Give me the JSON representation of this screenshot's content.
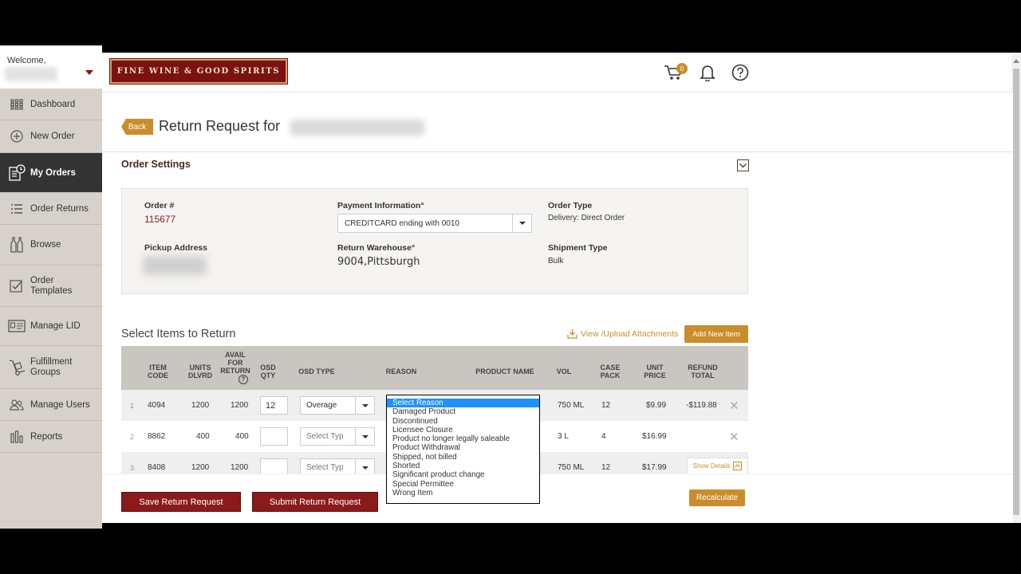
{
  "sidebar": {
    "welcome_label": "Welcome,",
    "items": [
      {
        "label": "Dashboard"
      },
      {
        "label": "New Order"
      },
      {
        "label": "My Orders"
      },
      {
        "label": "Order Returns"
      },
      {
        "label": "Browse"
      },
      {
        "label": "Order Templates"
      },
      {
        "label": "Manage LID"
      },
      {
        "label": "Fulfillment Groups"
      },
      {
        "label": "Manage Users"
      },
      {
        "label": "Reports"
      }
    ],
    "active_item": "My Orders"
  },
  "header": {
    "logo_text": "FINE WINE & GOOD SPIRITS",
    "cart_count": "0",
    "brand_color": "#7a1212",
    "accent_color": "#c98d2c"
  },
  "page": {
    "back_label": "Back",
    "title": "Return Request for"
  },
  "order_settings": {
    "title": "Order Settings",
    "order_num_label": "Order #",
    "order_num": "115677",
    "payment_label": "Payment Information°",
    "payment_value": "CREDITCARD ending with 0010",
    "order_type_label": "Order Type",
    "order_type": "Delivery: Direct Order",
    "pickup_label": "Pickup Address",
    "warehouse_label": "Return Warehouse°",
    "warehouse": "9004,Pittsburgh",
    "shipment_label": "Shipment Type",
    "shipment": "Bulk"
  },
  "items": {
    "title": "Select Items to Return",
    "attach_label": "View /Upload Attachments",
    "add_label": "Add New Item",
    "columns": {
      "item_code": "ITEM CODE",
      "units": "UNITS DLVRD",
      "avail": "AVAIL FOR RETURN",
      "osd_qty": "OSD QTY",
      "osd_type": "OSD TYPE",
      "reason": "REASON",
      "product": "PRODUCT NAME",
      "vol": "VOL",
      "case": "CASE PACK",
      "price": "UNIT PRICE",
      "refund": "REFUND TOTAL"
    },
    "rows": [
      {
        "n": "1",
        "code": "4094",
        "units": "1200",
        "avail": "1200",
        "qty": "12",
        "type": "Overage",
        "vol": "750 ML",
        "case": "12",
        "price": "$9.99",
        "refund": "-$119.88"
      },
      {
        "n": "2",
        "code": "8862",
        "units": "400",
        "avail": "400",
        "qty": "",
        "type": "Select Typ",
        "vol": "3 L",
        "case": "4",
        "price": "$16.99",
        "refund": ""
      },
      {
        "n": "3",
        "code": "8408",
        "units": "1200",
        "avail": "1200",
        "qty": "",
        "type": "Select Typ",
        "vol": "750 ML",
        "case": "12",
        "price": "$17.99",
        "refund": ""
      }
    ],
    "show_details": "Show Details"
  },
  "reason_dropdown": {
    "options": [
      "Select Reason",
      "Damaged Product",
      "Discontinued",
      "Licensee Closure",
      "Product no longer legally saleable",
      "Product Withdrawal",
      "Shipped, not billed",
      "Shorted",
      "Significant product change",
      "Special Permittee",
      "Wrong Item"
    ],
    "selected": "Select Reason"
  },
  "footer": {
    "save_label": "Save Return Request",
    "submit_label": "Submit Return Request",
    "recalc_label": "Recalculate"
  }
}
